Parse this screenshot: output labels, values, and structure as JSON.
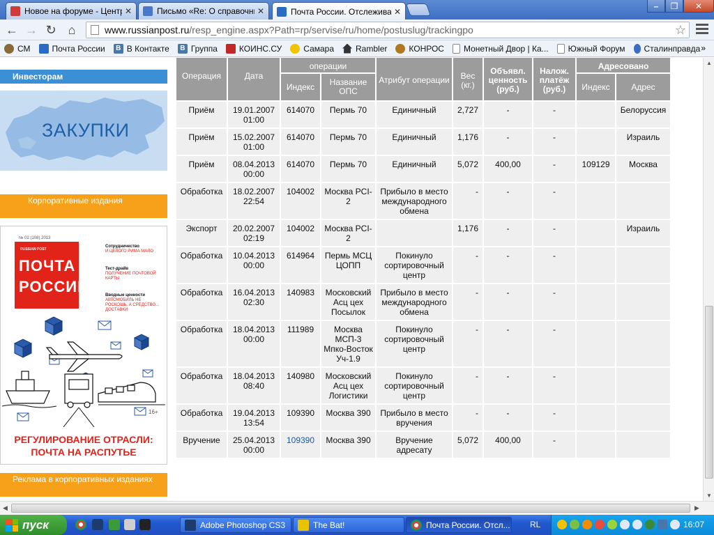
{
  "browser": {
    "tabs": [
      {
        "title": "Новое на форуме - Централ",
        "color": "#d03a3a"
      },
      {
        "title": "Письмо «Re: О справочник",
        "color": "#4a78c8"
      },
      {
        "title": "Почта России. Отслеживан",
        "color": "#2a6cc4"
      }
    ],
    "address": {
      "host": "www.russianpost.ru",
      "path": "/resp_engine.aspx?Path=rp/servise/ru/home/postuslug/trackingpo"
    },
    "bookmarks": [
      {
        "label": "СМ",
        "color": "#8a6a3a"
      },
      {
        "label": "Почта России",
        "color": "#2a6cc4"
      },
      {
        "label": "В Контакте",
        "color": "#4a76a8"
      },
      {
        "label": "Группа",
        "color": "#4a76a8"
      },
      {
        "label": "КОИНС.СУ",
        "color": "#c0282a"
      },
      {
        "label": "Самара",
        "color": "#f2c300"
      },
      {
        "label": "Rambler",
        "color": "#333333"
      },
      {
        "label": "КОНРОС",
        "color": "#b07820"
      },
      {
        "label": "Монетный Двор | Ка...",
        "color": "#ffffff"
      },
      {
        "label": "Южный Форум",
        "color": "#ffffff"
      },
      {
        "label": "Сталинправда",
        "color": "#3a6cc8"
      }
    ],
    "bookmarks_more": "»"
  },
  "sidebar": {
    "investors": "Инвесторам",
    "zakupki": "ЗАКУПКИ",
    "corporate": "Корпоративные издания",
    "ads": "Реклама в корпоративных изданиях",
    "magazine": {
      "issue": "№ 02 (108) 2013",
      "brand_small": "RUSSIAN POST",
      "brand_line1": "ПОЧТА",
      "brand_line2": "РОССИИ",
      "side_1_title": "Сотрудничество",
      "side_1_text": "И ЦЕЛОГО РИМА МАЛО",
      "side_2_title": "Тест-драйв",
      "side_2_text": "ПОЛУЧЕНИЕ ПОЧТОВОЙ КАРТЫ",
      "side_3_title": "Вводные ценности",
      "side_3_text": "АВТОМОБИЛЬ НЕ РОСКОШЬ, А СРЕДСТВО... ДОСТАВКИ",
      "age": "16+",
      "headline_1": "РЕГУЛИРОВАНИЕ ОТРАСЛИ:",
      "headline_2": "ПОЧТА НА РАСПУТЬЕ"
    }
  },
  "table": {
    "headers": {
      "operation": "Операция",
      "date": "Дата",
      "op_place": "операции",
      "index": "Индекс",
      "ops_name": "Название ОПС",
      "attribute": "Атрибут операции",
      "weight": "Вес (кг.)",
      "declared": "Объявл. ценность (руб.)",
      "cod": "Налож. платёж (руб.)",
      "addressed": "Адресовано",
      "addr_index": "Индекс",
      "address": "Адрес"
    },
    "rows": [
      {
        "op": "Приём",
        "date": "19.01.2007 01:00",
        "index": "614070",
        "ops": "Пермь 70",
        "attr": "Единичный",
        "weight": "2,727",
        "value": "-",
        "cod": "-",
        "aindex": "",
        "addr": "Белоруссия"
      },
      {
        "op": "Приём",
        "date": "15.02.2007 01:00",
        "index": "614070",
        "ops": "Пермь 70",
        "attr": "Единичный",
        "weight": "1,176",
        "value": "-",
        "cod": "-",
        "aindex": "",
        "addr": "Израиль"
      },
      {
        "op": "Приём",
        "date": "08.04.2013 00:00",
        "index": "614070",
        "ops": "Пермь 70",
        "attr": "Единичный",
        "weight": "5,072",
        "value": "400,00",
        "cod": "-",
        "aindex": "109129",
        "addr": "Москва"
      },
      {
        "op": "Обработка",
        "date": "18.02.2007 22:54",
        "index": "104002",
        "ops": "Москва PCI-2",
        "attr": "Прибыло в место международного обмена",
        "weight": "-",
        "value": "-",
        "cod": "-",
        "aindex": "",
        "addr": ""
      },
      {
        "op": "Экспорт",
        "date": "20.02.2007 02:19",
        "index": "104002",
        "ops": "Москва PCI-2",
        "attr": "",
        "weight": "1,176",
        "value": "-",
        "cod": "-",
        "aindex": "",
        "addr": "Израиль"
      },
      {
        "op": "Обработка",
        "date": "10.04.2013 00:00",
        "index": "614964",
        "ops": "Пермь МСЦ ЦОПП",
        "attr": "Покинуло сортировочный центр",
        "weight": "-",
        "value": "-",
        "cod": "-",
        "aindex": "",
        "addr": ""
      },
      {
        "op": "Обработка",
        "date": "16.04.2013 02:30",
        "index": "140983",
        "ops": "Московский Асц цех Посылок",
        "attr": "Прибыло в место международного обмена",
        "weight": "-",
        "value": "-",
        "cod": "-",
        "aindex": "",
        "addr": ""
      },
      {
        "op": "Обработка",
        "date": "18.04.2013 00:00",
        "index": "111989",
        "ops": "Москва МСП-3 Мпко-Восток Уч-1.9",
        "attr": "Покинуло сортировочный центр",
        "weight": "-",
        "value": "-",
        "cod": "-",
        "aindex": "",
        "addr": ""
      },
      {
        "op": "Обработка",
        "date": "18.04.2013 08:40",
        "index": "140980",
        "ops": "Московский Асц цех Логистики",
        "attr": "Покинуло сортировочный центр",
        "weight": "-",
        "value": "-",
        "cod": "-",
        "aindex": "",
        "addr": ""
      },
      {
        "op": "Обработка",
        "date": "19.04.2013 13:54",
        "index": "109390",
        "ops": "Москва 390",
        "attr": "Прибыло в место вручения",
        "weight": "-",
        "value": "-",
        "cod": "-",
        "aindex": "",
        "addr": ""
      },
      {
        "op": "Вручение",
        "date": "25.04.2013 00:00",
        "index": "109390",
        "index_link": true,
        "ops": "Москва 390",
        "attr": "Вручение адресату",
        "weight": "5,072",
        "value": "400,00",
        "cod": "-",
        "aindex": "",
        "addr": ""
      }
    ]
  },
  "taskbar": {
    "start": "пуск",
    "tasks": [
      {
        "label": "Adobe Photoshop CS3",
        "color": "#1c3c6e"
      },
      {
        "label": "The Bat!",
        "color": "#e8c400"
      },
      {
        "label": "Почта России. Отсл...",
        "color": "#2a6cc4"
      }
    ],
    "lang": "RL",
    "clock": "16:07"
  }
}
